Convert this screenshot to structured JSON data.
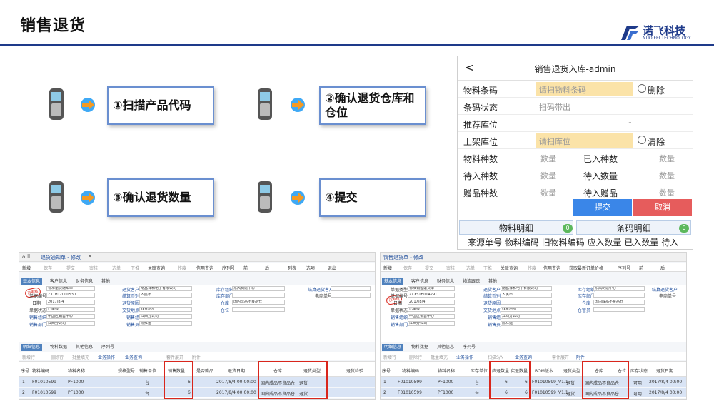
{
  "slide": {
    "title": "销售退货"
  },
  "logo": {
    "name": "诺飞科技",
    "sub": "NUO FEI TECHNOLOGY"
  },
  "steps": [
    {
      "label": "①扫描产品代码"
    },
    {
      "label": "②确认退货仓库和仓位"
    },
    {
      "label": "③确认退货数量"
    },
    {
      "label": "④提交"
    }
  ],
  "mobile": {
    "back": "<",
    "title": "销售退货入库-admin",
    "rows": {
      "material_code": "物料条码",
      "material_code_ph": "请扫物料条码",
      "delete": "删除",
      "barcode_status": "条码状态",
      "barcode_status_val": "扫码带出",
      "recommend_loc": "推荐库位",
      "putaway_loc": "上架库位",
      "putaway_loc_ph": "请扫库位",
      "clear": "清除",
      "material_kinds": "物料种数",
      "qty": "数量",
      "entered_kinds": "已入种数",
      "pending_kinds": "待入种数",
      "pending_qty": "待入数量",
      "gift_kinds": "赠品种数",
      "pending_gift": "待入赠品"
    },
    "submit": "提交",
    "cancel": "取消",
    "tabs": [
      {
        "label": "物料明细",
        "badge": "0"
      },
      {
        "label": "条码明细",
        "badge": "0"
      }
    ],
    "columns": [
      "来源单号",
      "物料编码",
      "旧物料编码",
      "应入数量",
      "已入数量",
      "待入"
    ]
  },
  "erp_left": {
    "title": "退货通知单 - 修改",
    "toolbar": [
      "新增",
      "保存",
      "提交",
      "审核",
      "选单",
      "下推",
      "关联查询",
      "作废",
      "信用查询",
      "序列号",
      "前一",
      "后一",
      "列表",
      "选项",
      "退出"
    ],
    "tabs": [
      "基本信息",
      "客户信息",
      "财务信息",
      "其他"
    ],
    "seal": "已审核",
    "fields": {
      "doc_type_label": "单据类型",
      "doc_type": "标准退货通知单",
      "doc_no_label": "单据编号",
      "doc_no": "ZXTHTZ000530",
      "date_label": "日期",
      "date": "2017/8/4",
      "status_label": "单据状态",
      "status": "已审核",
      "sales_org_label": "销售组织",
      "sales_org": "中国区销售中心",
      "sales_dept_label": "销售部门",
      "sales_dept": "江西分公司",
      "return_customer_label": "退货客户",
      "return_customer": "南昌祥和电子有限公司",
      "currency_label": "结算币别",
      "currency": "人民币",
      "reason_label": "退货原因",
      "delivery_label": "交货地点",
      "delivery": "收货地址",
      "sales_group_label": "销售组",
      "sales_group": "江西分公司",
      "salesman_label": "销售员",
      "salesman": "陈红运",
      "stock_org_label": "库存组织",
      "stock_org": "东风制造中心",
      "stock_dept_label": "库存部门",
      "warehouse_label": "仓库",
      "warehouse": "国内成品不良品仓",
      "location_label": "仓位",
      "discount_label": "结算退货客户",
      "phone_label": "电商单号"
    },
    "detail_tabs": [
      "明细信息",
      "物料数据",
      "其他信息",
      "序列号"
    ],
    "detail_toolbar": [
      "新增行",
      "删除行",
      "批量填充",
      "业务操作",
      "业务查询",
      "套件展开",
      "附件"
    ],
    "columns": [
      "序号",
      "物料编码",
      "物料名称",
      "规格型号",
      "销售单位",
      "销售数量",
      "是否赠品",
      "退货日期",
      "仓库",
      "退货类型",
      "退货检验"
    ],
    "rows": [
      [
        "1",
        "F01010599",
        "PF1000",
        "",
        "台",
        "6",
        "",
        "2017/8/4 00:00:00",
        "国内成品不良品仓",
        "退货",
        ""
      ],
      [
        "2",
        "F01010599",
        "PF1000",
        "",
        "台",
        "6",
        "",
        "2017/8/4 00:00:00",
        "国内成品不良品仓",
        "退货",
        ""
      ]
    ]
  },
  "erp_right": {
    "title": "销售退货单 - 修改",
    "toolbar": [
      "新增",
      "保存",
      "提交",
      "审核",
      "选单",
      "下推",
      "关联查询",
      "作废",
      "信用查询",
      "获取最新订单价格",
      "序列号",
      "前一",
      "后一"
    ],
    "tabs": [
      "基本信息",
      "客户信息",
      "财务信息",
      "物流跟踪",
      "其他"
    ],
    "seal": "已审核",
    "fields": {
      "doc_type_label": "单据类型",
      "doc_type": "标准销售退货单",
      "doc_no_label": "单据编号",
      "doc_no": "ZXXSTH004291",
      "date_label": "日期",
      "date": "2017/8/4",
      "status_label": "单据状态",
      "status": "已审核",
      "sales_org_label": "销售组织",
      "sales_org": "中国区销售中心",
      "sales_dept_label": "销售部门",
      "sales_dept": "江西分公司",
      "return_customer_label": "退货客户",
      "return_customer": "南昌祥和电子有限公司",
      "currency_label": "结算币别",
      "currency": "人民币",
      "reason_label": "退货原因",
      "delivery_label": "交货地点",
      "delivery": "收货地址",
      "sales_group_label": "销售组",
      "sales_group": "江西分公司",
      "salesman_label": "销售员",
      "salesman": "陈红运",
      "stock_org_label": "库存组织",
      "stock_org": "东风制造中心",
      "stock_dept_label": "库存部门",
      "warehouse_label": "仓库",
      "warehouse": "国内成品不良品仓",
      "location_label": "仓管员",
      "discount_label": "结算退货客户",
      "phone_label": "电商单号"
    },
    "detail_tabs": [
      "明细信息",
      "物料数据",
      "其他信息",
      "序列号"
    ],
    "detail_toolbar": [
      "新增行",
      "删除行",
      "批量填充",
      "业务操作",
      "扫描S/N",
      "业务查询",
      "套件展开",
      "附件"
    ],
    "columns": [
      "序号",
      "物料编码",
      "物料名称",
      "库存单位",
      "应退数量",
      "实退数量",
      "BOM版本",
      "退货类型",
      "仓库",
      "仓位",
      "库存状态",
      "退货日期"
    ],
    "rows": [
      [
        "1",
        "F01010599",
        "PF1000",
        "台",
        "6",
        "6",
        "F01010599_V1.1",
        "退货",
        "国内成品不良品仓",
        "",
        "可用",
        "2017/8/4 00:00"
      ],
      [
        "2",
        "F01010599",
        "PF1000",
        "台",
        "6",
        "6",
        "F01010599_V1.1",
        "退货",
        "国内成品不良品仓",
        "",
        "可用",
        "2017/8/4 00:00"
      ]
    ]
  }
}
